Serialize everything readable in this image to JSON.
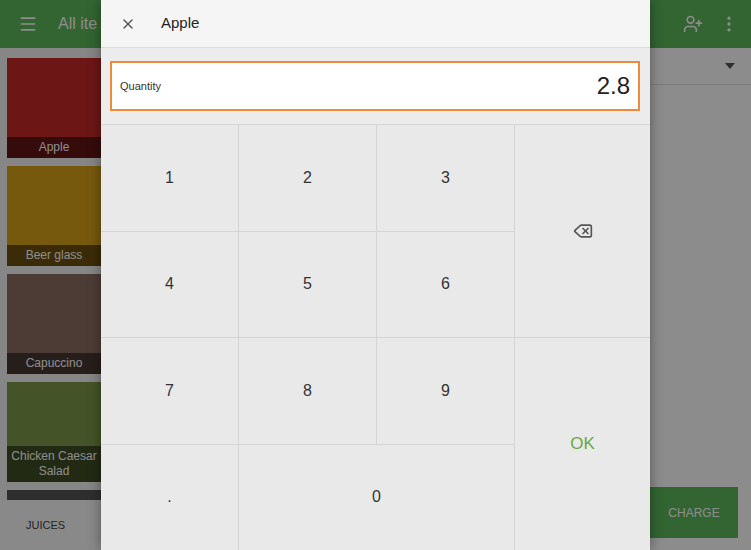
{
  "app": {
    "title": "All ite",
    "items": [
      {
        "name": "Apple"
      },
      {
        "name": "Beer glass"
      },
      {
        "name": "Capuccino"
      },
      {
        "name": "Chicken Caesar Salad"
      }
    ],
    "categories": [
      "JUICES"
    ],
    "charge_button": "CHARGE"
  },
  "dialog": {
    "title": "Apple",
    "quantity": {
      "label": "Quantity",
      "value": "2.8",
      "focused": true
    },
    "keys": [
      "1",
      "2",
      "3",
      "4",
      "5",
      "6",
      "7",
      "8",
      "9",
      ".",
      "0"
    ],
    "ok_button": "OK"
  }
}
